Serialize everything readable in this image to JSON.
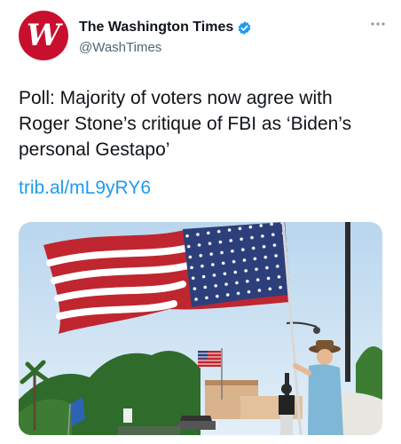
{
  "account": {
    "display_name": "The Washington Times",
    "handle": "@WashTimes",
    "avatar_letter": "W",
    "verified": true
  },
  "tweet": {
    "text": "Poll: Majority of voters now agree with Roger Stone’s critique of FBI as ‘Biden’s personal Gestapo’",
    "link": "trib.al/mL9yRY6"
  },
  "media": {
    "icon": "photo",
    "colors": {
      "sky": "#c9e0f2",
      "flag_red": "#c0262f",
      "flag_blue": "#2c3f7a",
      "foliage": "#2f6b2a"
    }
  },
  "icons": {
    "more": "more-icon",
    "verified": "verified-badge-icon"
  },
  "colors": {
    "brand_red": "#c8102e",
    "link_blue": "#1d9bf0",
    "muted": "#536471"
  }
}
